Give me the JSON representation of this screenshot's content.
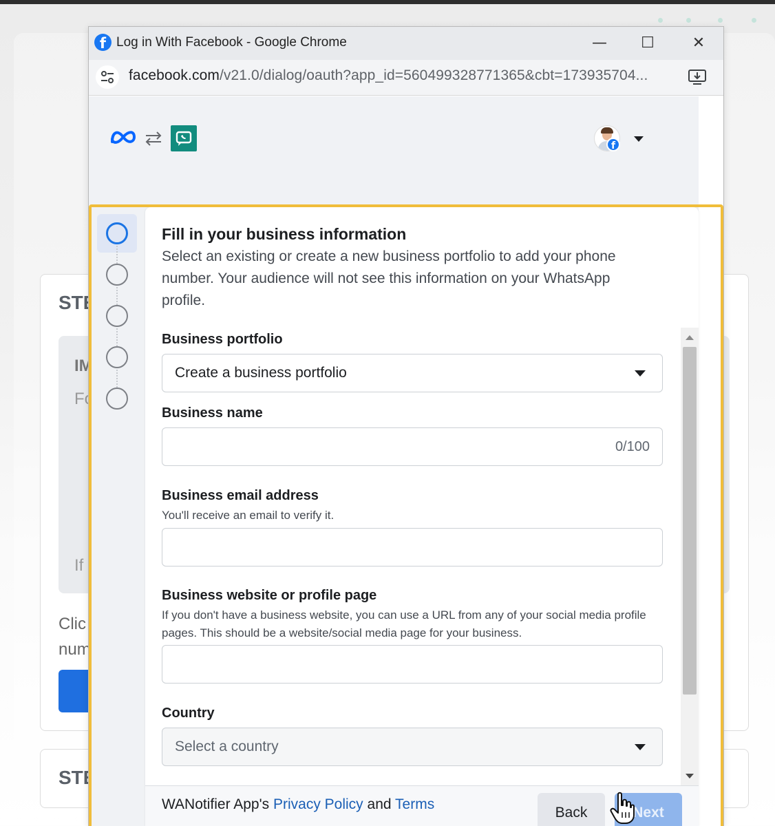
{
  "window": {
    "title": "Log in With Facebook - Google Chrome",
    "url_domain": "facebook.com",
    "url_path": "/v21.0/dialog/oauth?app_id=560499328771365&cbt=173935704...",
    "controls": {
      "minimize": "—",
      "maximize": "☐",
      "close": "✕"
    },
    "favicon_letter": "f"
  },
  "background_page": {
    "step_title_1": "STE",
    "inner_title": "IM",
    "inner_text_1": "Fo",
    "inner_text_2": "If",
    "text_click": "Clic",
    "text_num": "num",
    "step_title_2": "STE"
  },
  "popup": {
    "icons": [
      "meta-logo-icon",
      "swap-arrows-icon",
      "wanotifier-app-icon",
      "account-avatar",
      "chevron-down-icon"
    ],
    "avatar_badge": "f"
  },
  "form": {
    "title": "Fill in your business information",
    "description": "Select an existing or create a new business portfolio to add your phone number. Your audience will not see this information on your WhatsApp profile.",
    "fields": {
      "portfolio": {
        "label": "Business portfolio",
        "value": "Create a business portfolio"
      },
      "name": {
        "label": "Business name",
        "counter": "0/100",
        "value": ""
      },
      "email": {
        "label": "Business email address",
        "help": "You'll receive an email to verify it.",
        "value": ""
      },
      "website": {
        "label": "Business website or profile page",
        "help": "If you don't have a business website, you can use a URL from any of your social media profile pages. This should be a website/social media page for your business.",
        "value": ""
      },
      "country": {
        "label": "Country",
        "placeholder": "Select a country"
      }
    },
    "steps_count": 5,
    "active_step": 1
  },
  "footer": {
    "prefix": "WANotifier App's",
    "privacy_link": "Privacy Policy",
    "and": "and",
    "terms_link": "Terms",
    "back_label": "Back",
    "next_label": "Next"
  },
  "colors": {
    "facebook_blue": "#1877f2",
    "highlight": "#f0bd3a",
    "app_green": "#128c7e",
    "next_disabled": "#8fb5ec"
  }
}
